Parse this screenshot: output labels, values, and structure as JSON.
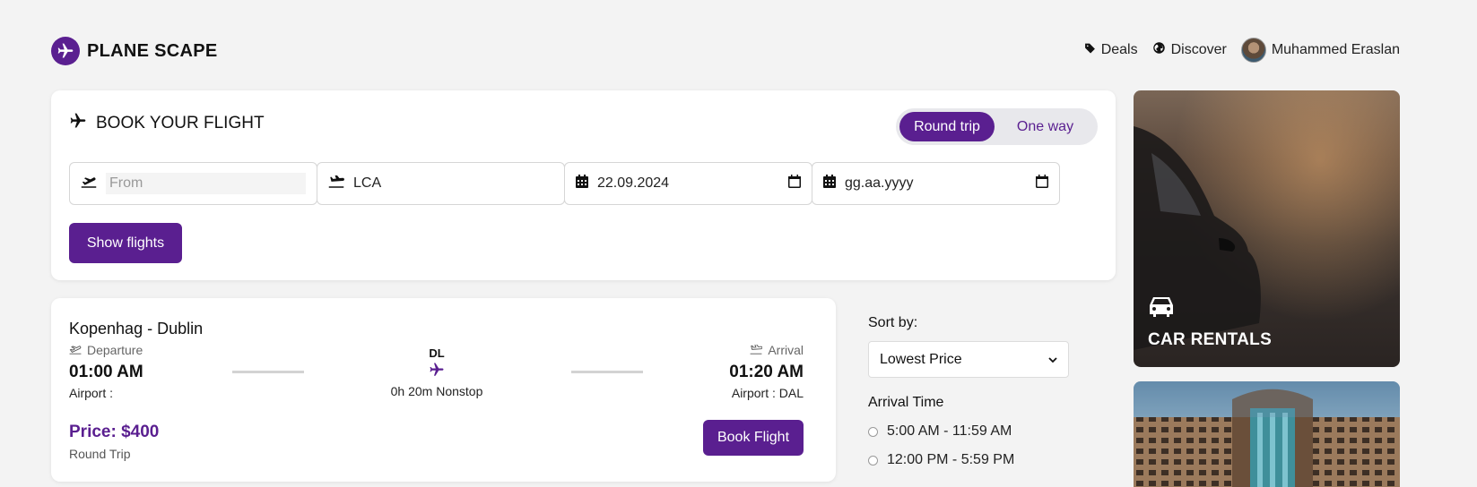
{
  "header": {
    "brand": "PLANE SCAPE",
    "nav": [
      {
        "label": "Deals",
        "icon": "tag-icon"
      },
      {
        "label": "Discover",
        "icon": "globe-icon"
      }
    ],
    "user": {
      "name": "Muhammed Eraslan"
    }
  },
  "booking": {
    "title": "BOOK YOUR FLIGHT",
    "trip_types": {
      "round": "Round trip",
      "oneway": "One way",
      "selected": "Round trip"
    },
    "from": {
      "placeholder": "From",
      "value": ""
    },
    "to": {
      "value": "LCA"
    },
    "depart_date": "22.09.2024",
    "return_date": "gg.aa.yyyy",
    "show_button": "Show flights"
  },
  "flight": {
    "route": "Kopenhag - Dublin",
    "departure_label": "Departure",
    "departure_time": "01:00 AM",
    "departure_airport": "Airport :",
    "airline_code": "DL",
    "duration": "0h 20m Nonstop",
    "arrival_label": "Arrival",
    "arrival_time": "01:20 AM",
    "arrival_airport": "Airport : DAL",
    "price": "Price: $400",
    "trip_type": "Round Trip",
    "book_button": "Book Flight"
  },
  "filters": {
    "sort_label": "Sort by:",
    "sort_value": "Lowest Price",
    "arrival_time_label": "Arrival Time",
    "arrival_options": [
      "5:00 AM - 11:59 AM",
      "12:00 PM - 5:59 PM"
    ]
  },
  "promos": {
    "car": {
      "title": "CAR RENTALS",
      "icon": "car-icon"
    },
    "hotel": {
      "title": ""
    }
  },
  "colors": {
    "brand": "#5a1f90",
    "background": "#f3f3f3",
    "card": "#ffffff"
  }
}
